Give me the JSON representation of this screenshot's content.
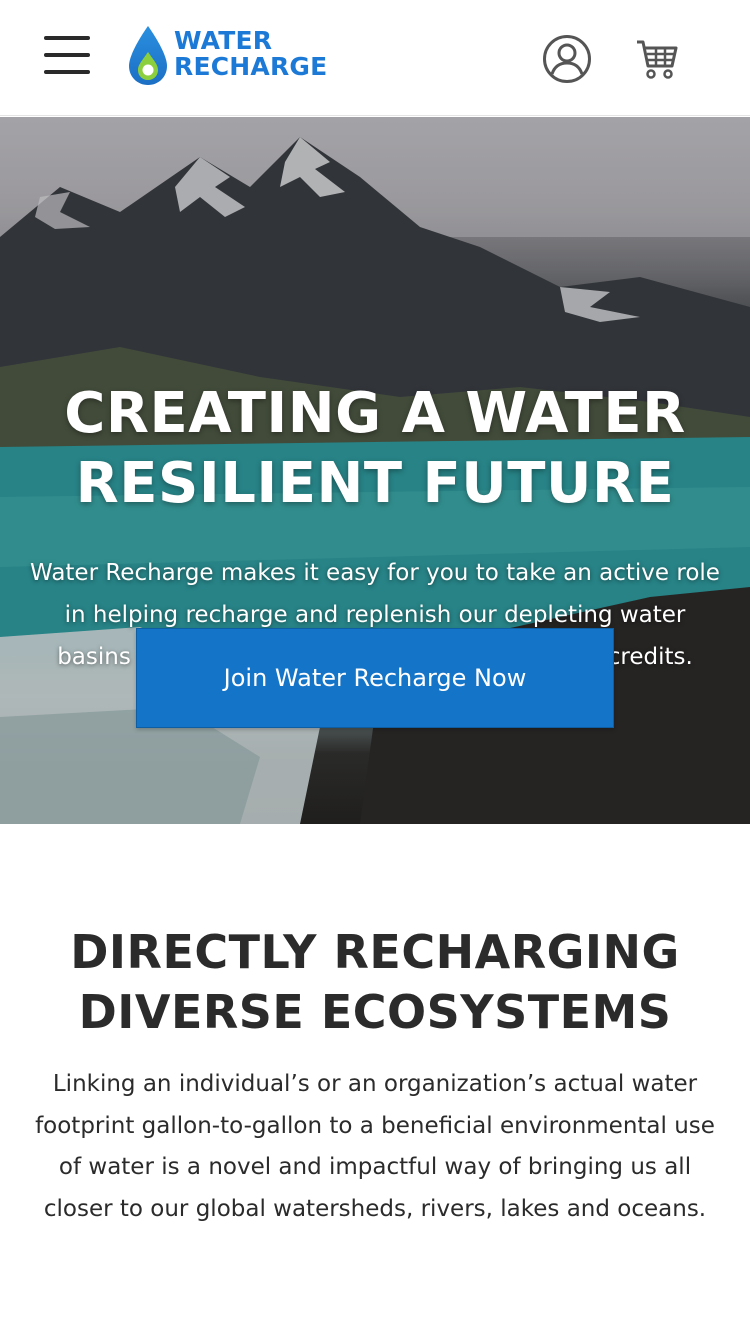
{
  "header": {
    "menu_icon": "hamburger-menu-icon",
    "logo": {
      "line1": "WATER",
      "line2": "RECHARGE",
      "colors": {
        "primary": "#1c7ad6",
        "drop_inner": "#8ccf3e"
      }
    },
    "account_icon": "user-circle-icon",
    "cart_icon": "shopping-cart-icon"
  },
  "hero": {
    "title_line1": "CREATING A WATER",
    "title_line2": "RESILIENT FUTURE",
    "description": "Water Recharge makes it easy for you to take an active role in helping recharge and replenish our depleting water basins and river systems through buying water credits.",
    "cta_label": "Join Water Recharge Now",
    "cta_color": "#1474c8"
  },
  "section": {
    "title_line1": "DIRECTLY RECHARGING",
    "title_line2": "DIVERSE ECOSYSTEMS",
    "body": "Linking an individual’s or an organization’s actual water footprint gallon-to-gallon to a beneficial environmental use of water is a novel and impactful way of bringing us all closer to our global watersheds, rivers, lakes and oceans."
  }
}
